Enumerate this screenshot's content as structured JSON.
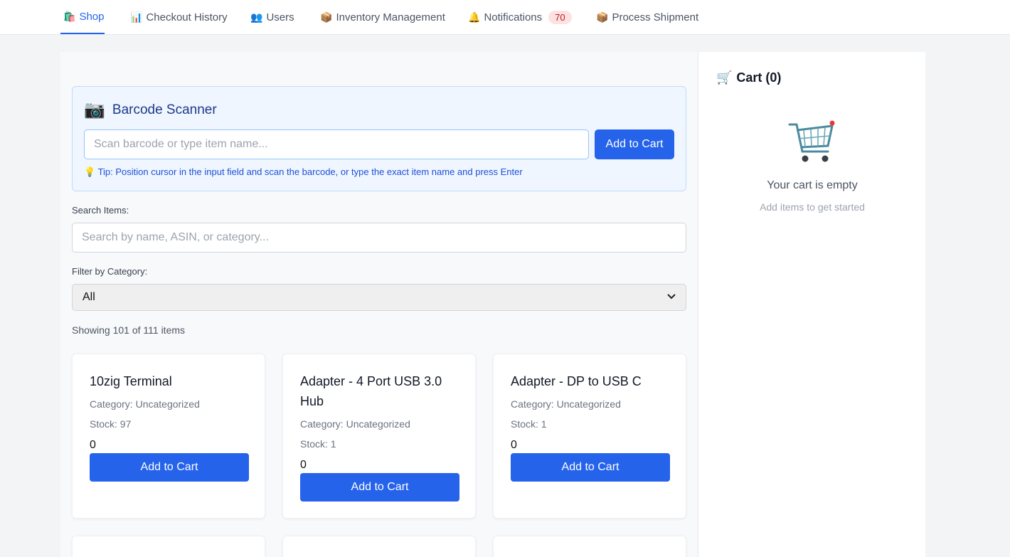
{
  "nav": {
    "tabs": [
      {
        "icon": "🛍️",
        "label": "Shop"
      },
      {
        "icon": "📊",
        "label": "Checkout History"
      },
      {
        "icon": "👥",
        "label": "Users"
      },
      {
        "icon": "📦",
        "label": "Inventory Management"
      },
      {
        "icon": "🔔",
        "label": "Notifications",
        "badge": "70"
      },
      {
        "icon": "📦",
        "label": "Process Shipment"
      }
    ],
    "active_tab": "Shop"
  },
  "scanner": {
    "icon": "📷",
    "title": "Barcode Scanner",
    "placeholder": "Scan barcode or type item name...",
    "button": "Add to Cart",
    "tip": "💡 Tip: Position cursor in the input field and scan the barcode, or type the exact item name and press Enter"
  },
  "search": {
    "label": "Search Items:",
    "placeholder": "Search by name, ASIN, or category..."
  },
  "filter": {
    "label": "Filter by Category:",
    "selected": "All"
  },
  "showing": "Showing 101 of 111 items",
  "items": [
    {
      "name": "10zig Terminal",
      "category": "Category: Uncategorized",
      "stock": "Stock: 97",
      "price": "0",
      "button": "Add to Cart"
    },
    {
      "name": "Adapter - 4 Port USB 3.0 Hub",
      "category": "Category: Uncategorized",
      "stock": "Stock: 1",
      "price": "0",
      "button": "Add to Cart"
    },
    {
      "name": "Adapter - DP to USB C",
      "category": "Category: Uncategorized",
      "stock": "Stock: 1",
      "price": "0",
      "button": "Add to Cart"
    }
  ],
  "cart": {
    "icon": "🛒",
    "title": "Cart (0)",
    "empty_text": "Your cart is empty",
    "empty_sub": "Add items to get started"
  },
  "colors": {
    "accent": "#2563eb",
    "badge_bg": "#fee2e2",
    "badge_text": "#b91c1c",
    "scanner_bg": "#eff6ff"
  }
}
